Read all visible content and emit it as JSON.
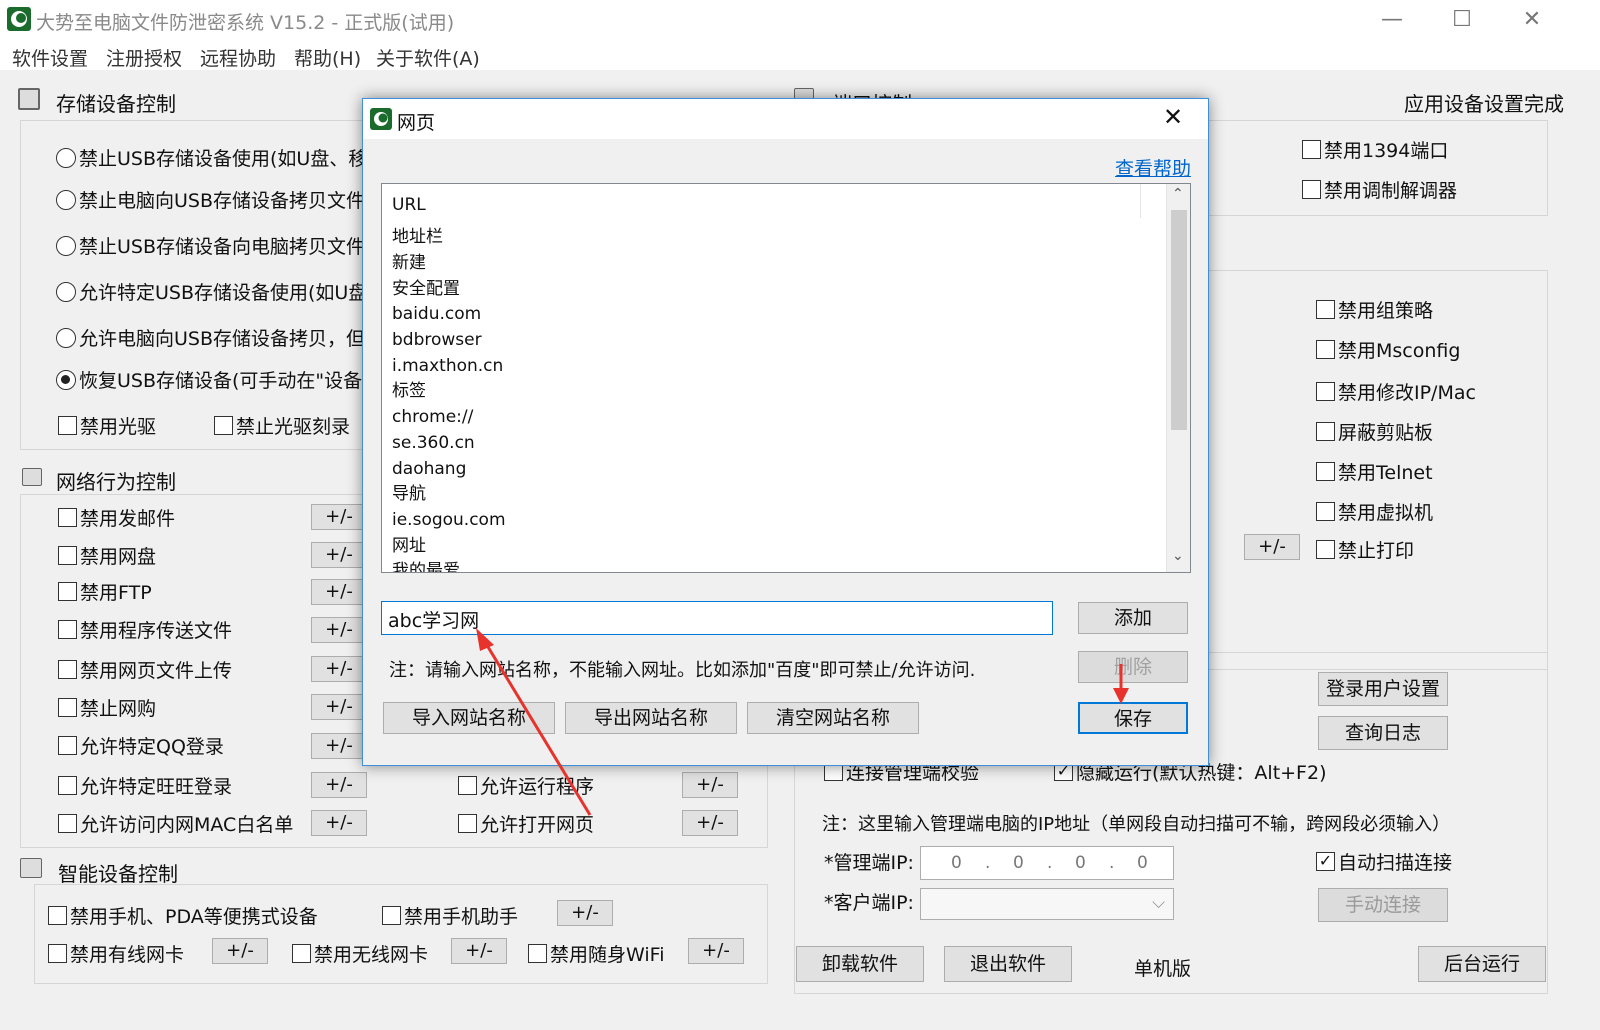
{
  "window": {
    "title": "大势至电脑文件防泄密系统 V15.2 - 正式版(试用)",
    "minimize": "—",
    "maximize": "☐",
    "close": "✕"
  },
  "menu": [
    "软件设置",
    "注册授权",
    "远程协助",
    "帮助(H)",
    "关于软件(A)"
  ],
  "storage": {
    "title": "存储设备控制",
    "radios": [
      "禁止USB存储设备使用(如U盘、移动",
      "禁止电脑向USB存储设备拷贝文件",
      "禁止USB存储设备向电脑拷贝文件",
      "允许特定USB存储设备使用(如U盘、",
      "允许电脑向USB存储设备拷贝，但必",
      "恢复USB存储设备(可手动在\"设备管"
    ],
    "selected_index": 5,
    "cd_disable": "禁用光驱",
    "cd_burn": "禁止光驱刻录"
  },
  "port": {
    "title": "端口控制",
    "status": "应用设备设置完成",
    "disable_1394": "禁用1394端口",
    "disable_modem": "禁用调制解调器"
  },
  "system_options": [
    "禁用组策略",
    "禁用Msconfig",
    "禁用修改IP/Mac",
    "屏蔽剪贴板",
    "禁用Telnet",
    "禁用虚拟机",
    "禁止打印"
  ],
  "network": {
    "title": "网络行为控制",
    "items": [
      "禁用发邮件",
      "禁用网盘",
      "禁用FTP",
      "禁用程序传送文件",
      "禁用网页文件上传",
      "禁止网购",
      "允许特定QQ登录",
      "允许特定旺旺登录",
      "允许访问内网MAC白名单"
    ],
    "pm": "+/-",
    "allow_program": "允许运行程序",
    "allow_web": "允许打开网页"
  },
  "smart": {
    "title": "智能设备控制",
    "phone": "禁用手机、PDA等便携式设备",
    "phone_helper": "禁用手机助手",
    "wired": "禁用有线网卡",
    "wireless": "禁用无线网卡",
    "wifi": "禁用随身WiFi"
  },
  "admin": {
    "login_settings": "登录用户设置",
    "query_log": "查询日志",
    "connect_verify": "连接管理端校验",
    "hidden_run": "隐藏运行(默认热键：Alt+F2)",
    "note": "注：这里输入管理端电脑的IP地址（单网段自动扫描可不输，跨网段必须输入）",
    "admin_ip_label": "*管理端IP:",
    "admin_ip": [
      "0",
      "0",
      "0",
      "0"
    ],
    "client_ip_label": "*客户端IP:",
    "auto_scan": "自动扫描连接",
    "manual_connect": "手动连接"
  },
  "bottom": {
    "uninstall": "卸载软件",
    "exit": "退出软件",
    "edition": "单机版",
    "background": "后台运行"
  },
  "dialog": {
    "title": "网页",
    "help": "查看帮助",
    "list_header": "URL",
    "list": [
      "地址栏",
      "新建",
      "安全配置",
      "baidu.com",
      "bdbrowser",
      "i.maxthon.cn",
      "标签",
      "chrome://",
      "se.360.cn",
      "daohang",
      "导航",
      "ie.sogou.com",
      "网址",
      "我的最爱"
    ],
    "input_value": "abc学习网",
    "add": "添加",
    "delete": "删除",
    "note": "注：请输入网站名称，不能输入网址。比如添加\"百度\"即可禁止/允许访问.",
    "import": "导入网站名称",
    "export": "导出网站名称",
    "clear": "清空网站名称",
    "save": "保存"
  },
  "colors": {
    "accent": "#0078d7",
    "arrow": "#e8322c",
    "link": "#0066cc"
  }
}
